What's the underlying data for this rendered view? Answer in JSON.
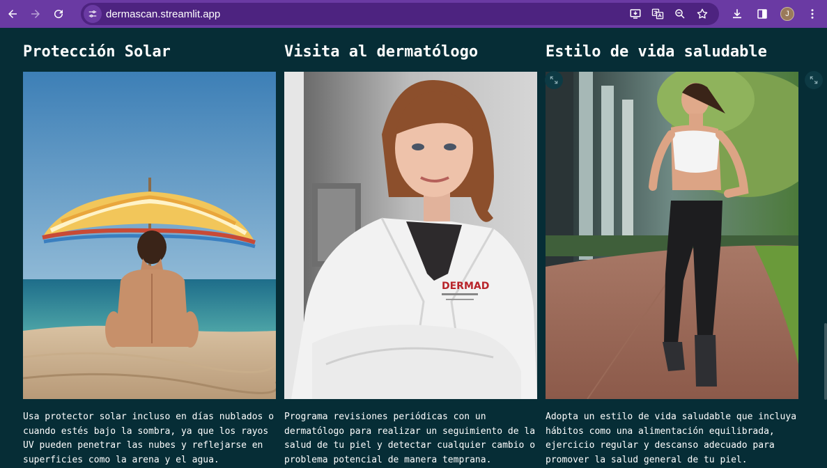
{
  "browser": {
    "url": "dermascan.streamlit.app",
    "avatar_initial": "J"
  },
  "columns": [
    {
      "title": "Protección Solar",
      "text": "Usa protector solar incluso en días nublados o cuando estés bajo la sombra, ya que los rayos UV pueden penetrar las nubes y reflejarse en superficies como la arena y el agua."
    },
    {
      "title": "Visita al dermatólogo",
      "text": "Programa revisiones periódicas con un dermatólogo para realizar un seguimiento de la salud de tu piel y detectar cualquier cambio o problema potencial de manera temprana.",
      "coat_logo": "DERMAD"
    },
    {
      "title": "Estilo de vida saludable",
      "text": "Adopta un estilo de vida saludable que incluya hábitos como una alimentación equilibrada, ejercicio regular y descanso adecuado para promover la salud general de tu piel."
    }
  ],
  "colors": {
    "background": "#062d36",
    "chrome": "#6a3aa3",
    "omnibox": "#4d2380"
  }
}
